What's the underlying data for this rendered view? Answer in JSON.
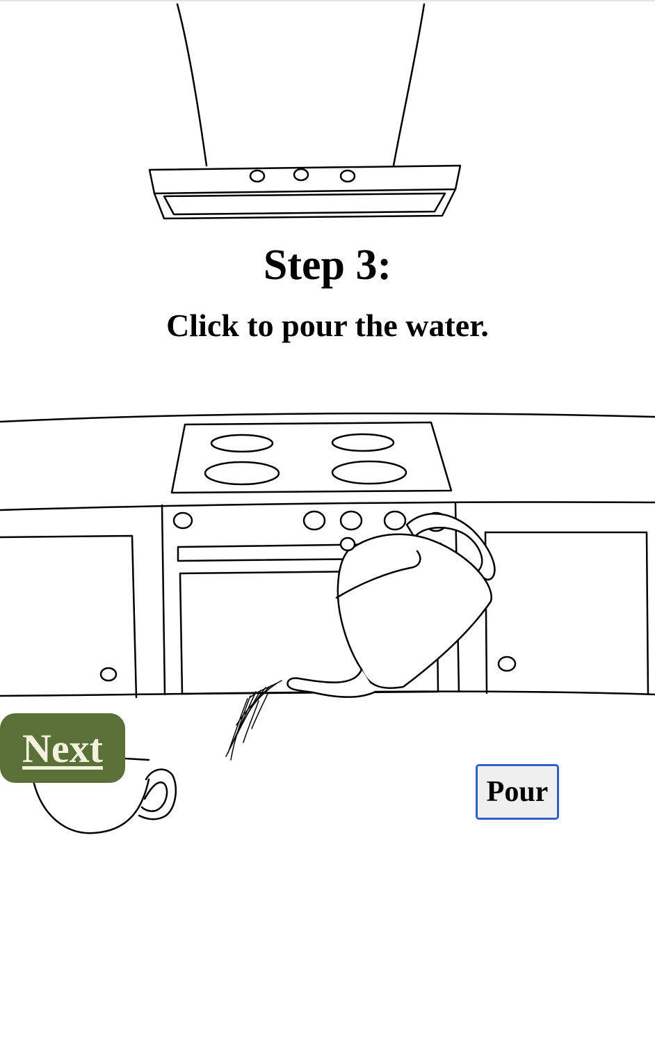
{
  "step": {
    "title": "Step 3:",
    "instruction": "Click to pour the water."
  },
  "buttons": {
    "next_label": "Next",
    "pour_label": "Pour"
  },
  "colors": {
    "next_button_bg": "#5a7037",
    "next_button_text": "#f3f1e0",
    "pour_button_border": "#2d5fc4",
    "pour_button_bg": "#efefef",
    "line_art": "#000000"
  },
  "illustration": {
    "icons": [
      "range-hood-icon",
      "stove-icon",
      "kitchen-cabinet-icon",
      "teapot-icon",
      "water-stream-icon",
      "teacup-icon"
    ]
  }
}
